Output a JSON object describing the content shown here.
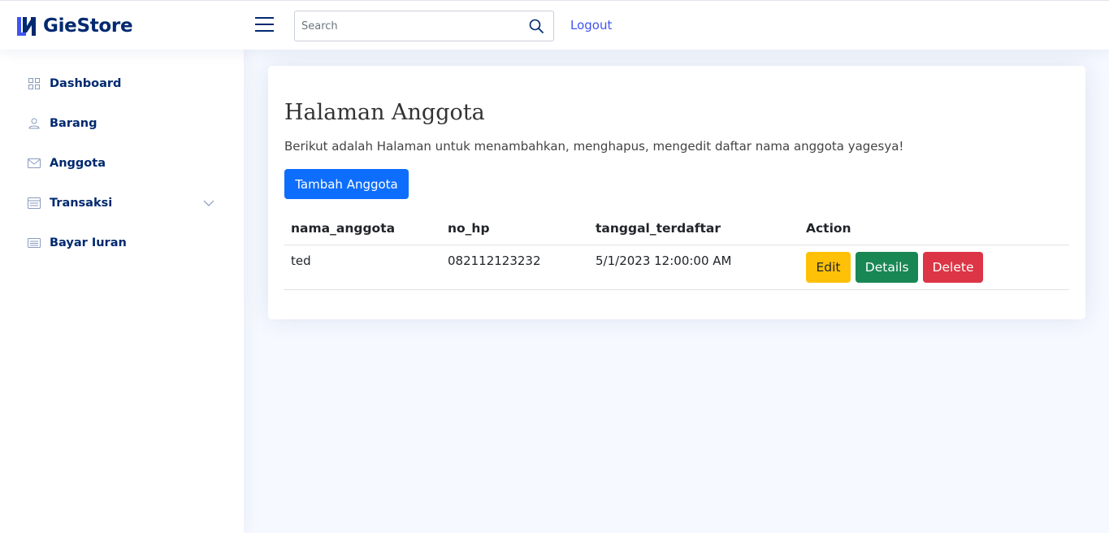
{
  "app": {
    "name": "GieStore",
    "brand_color": "#012970",
    "accent_color": "#4154f1"
  },
  "header": {
    "search_placeholder": "Search",
    "logout_label": "Logout"
  },
  "sidebar": {
    "items": [
      {
        "label": "Dashboard",
        "icon": "grid-icon"
      },
      {
        "label": "Barang",
        "icon": "person-icon"
      },
      {
        "label": "Anggota",
        "icon": "envelope-icon"
      },
      {
        "label": "Transaksi",
        "icon": "layout-text-window-icon",
        "has_dropdown": true
      },
      {
        "label": "Bayar Iuran",
        "icon": "card-list-icon"
      }
    ]
  },
  "main": {
    "title": "Halaman Anggota",
    "description": "Berikut adalah Halaman untuk menambahkan, menghapus, mengedit daftar nama anggota yagesya!",
    "add_button_label": "Tambah Anggota",
    "table": {
      "columns": [
        "nama_anggota",
        "no_hp",
        "tanggal_terdaftar",
        "Action"
      ],
      "rows": [
        {
          "nama_anggota": "ted",
          "no_hp": "082112123232",
          "tanggal_terdaftar": "5/1/2023 12:00:00 AM"
        }
      ],
      "row_actions": {
        "edit": "Edit",
        "details": "Details",
        "delete": "Delete"
      }
    }
  },
  "colors": {
    "primary": "#0d6efd",
    "warning": "#ffc107",
    "success": "#198754",
    "danger": "#dc3545"
  }
}
